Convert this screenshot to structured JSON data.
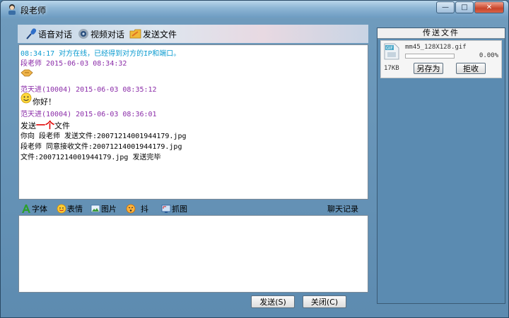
{
  "window": {
    "title": "段老师"
  },
  "toolbar": {
    "voice_label": "语音对话",
    "video_label": "视频对话",
    "send_file_label": "发送文件"
  },
  "log": [
    {
      "text": "08:34:17  对方在线，已经得到对方的IP和端口。"
    },
    {
      "text": "段老师 2015-06-03 08:34:32"
    },
    {
      "text": "范天进(10004) 2015-06-03 08:35:12"
    },
    {
      "text": "你好！"
    },
    {
      "text": "范天进(10004) 2015-06-03 08:36:01"
    },
    {
      "pre": "发送",
      "highlight": "一个",
      "post": "文件"
    },
    {
      "text": "你向 段老师 发送文件:20071214001944179.jpg"
    },
    {
      "text": "段老师 同意接收文件:20071214001944179.jpg"
    },
    {
      "text": "文件:20071214001944179.jpg 发送完毕"
    }
  ],
  "toolbar2": {
    "font_label": "字体",
    "emoji_label": "表情",
    "image_label": "图片",
    "shake_label": "抖",
    "capture_label": "抓图",
    "history_label": "聊天记录"
  },
  "buttons": {
    "send_label": "发送(S)",
    "close_label": "关闭(C)"
  },
  "transfer": {
    "header": "传送文件",
    "icon_text": "GIF",
    "file_name": "mm45_128X128.gif",
    "percent": "0.00%",
    "progress": 0.0,
    "size": "17KB",
    "save_as_label": "另存为",
    "reject_label": "拒收"
  },
  "colors": {
    "system_text": "#0a9bd0",
    "sender_text": "#8a2ba8",
    "highlight_text": "#e00000"
  }
}
